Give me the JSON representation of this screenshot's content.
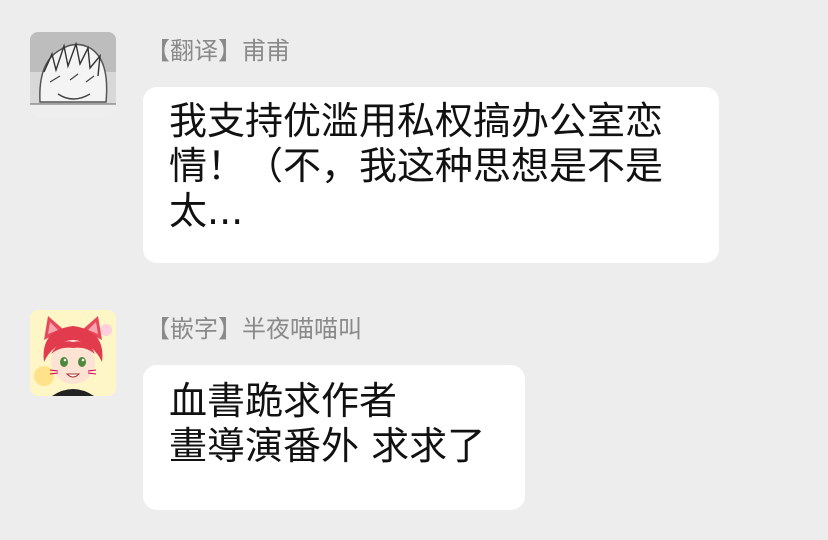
{
  "messages": [
    {
      "sender": "【翻译】甫甫",
      "avatar_icon": "manga-character-avatar-icon",
      "lines": [
        "我支持优滥用私权搞办公室恋",
        "情！（不，我这种思想是不是",
        "太..."
      ]
    },
    {
      "sender": "【嵌字】半夜喵喵叫",
      "avatar_icon": "cat-ear-girl-avatar-icon",
      "lines": [
        "血書跪求作者",
        "畫導演番外 求求了"
      ]
    }
  ],
  "colors": {
    "background": "#ededed",
    "bubble": "#ffffff",
    "sender_text": "#8a8a8a",
    "message_text": "#111111"
  }
}
